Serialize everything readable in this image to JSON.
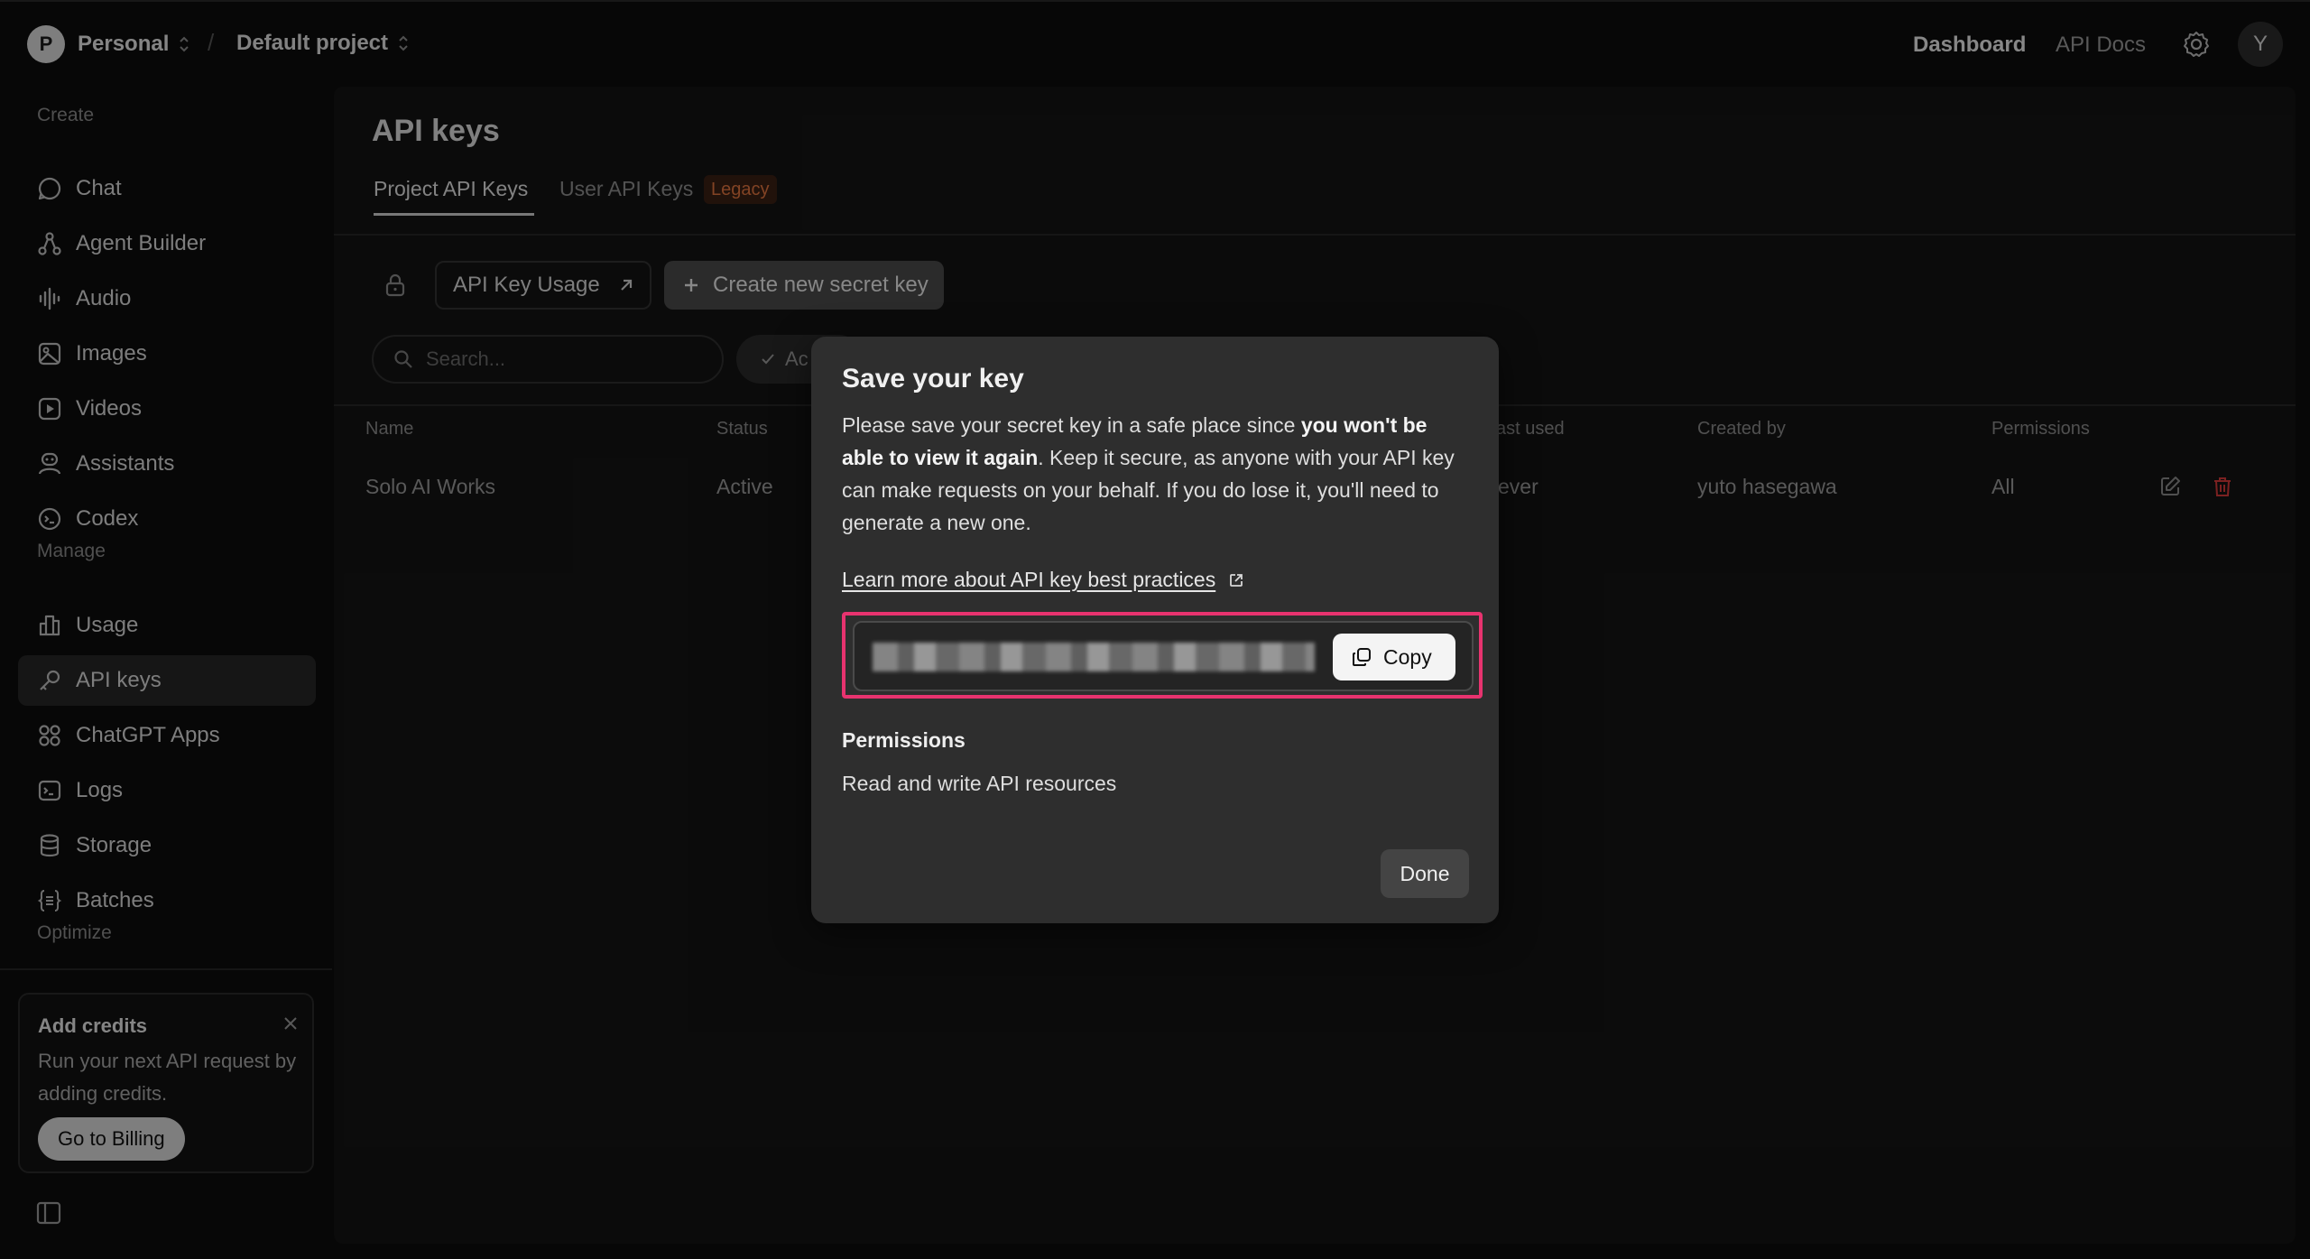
{
  "topbar": {
    "workspace_initial": "P",
    "workspace_name": "Personal",
    "project_name": "Default project",
    "separator": "/",
    "nav_dashboard": "Dashboard",
    "nav_api_docs": "API Docs",
    "user_initial": "Y"
  },
  "sidebar": {
    "section_create": "Create",
    "section_manage": "Manage",
    "section_optimize": "Optimize",
    "items": [
      {
        "label": "Chat",
        "icon": "chat-icon"
      },
      {
        "label": "Agent Builder",
        "icon": "agent-builder-icon"
      },
      {
        "label": "Audio",
        "icon": "audio-icon"
      },
      {
        "label": "Images",
        "icon": "images-icon"
      },
      {
        "label": "Videos",
        "icon": "videos-icon"
      },
      {
        "label": "Assistants",
        "icon": "assistants-icon"
      },
      {
        "label": "Codex",
        "icon": "codex-icon"
      },
      {
        "label": "Usage",
        "icon": "usage-icon"
      },
      {
        "label": "API keys",
        "icon": "key-icon",
        "active": true
      },
      {
        "label": "ChatGPT Apps",
        "icon": "apps-icon"
      },
      {
        "label": "Logs",
        "icon": "logs-icon"
      },
      {
        "label": "Storage",
        "icon": "storage-icon"
      },
      {
        "label": "Batches",
        "icon": "batches-icon"
      }
    ],
    "credits": {
      "title": "Add credits",
      "body": "Run your next API request by adding credits.",
      "button": "Go to Billing"
    }
  },
  "main": {
    "title": "API keys",
    "tabs": [
      {
        "label": "Project API Keys",
        "active": true
      },
      {
        "label": "User API Keys",
        "badge": "Legacy"
      }
    ],
    "usage_button": "API Key Usage",
    "create_button": "Create new secret key",
    "search_placeholder": "Search...",
    "filter_label": "Ac",
    "table": {
      "headers": [
        "Name",
        "Status",
        "ast used",
        "Created by",
        "Permissions"
      ],
      "rows": [
        {
          "name": "Solo AI Works",
          "status": "Active",
          "last_used": "ever",
          "created_by": "yuto hasegawa",
          "permissions": "All"
        }
      ]
    }
  },
  "modal": {
    "title": "Save your key",
    "body_1": "Please save your secret key in a safe place since ",
    "body_bold": "you won't be able to view it again",
    "body_2": ". Keep it secure, as anyone with your API key can make requests on your behalf. If you do lose it, you'll need to generate a new one.",
    "link": "Learn more about API key best practices",
    "copy_button": "Copy",
    "permissions_heading": "Permissions",
    "permissions_value": "Read and write API resources",
    "done_button": "Done"
  },
  "colors": {
    "background": "#0d0d0d",
    "panel": "#141414",
    "modal": "#2e2e2e",
    "highlight": "#e8336f",
    "legacy_badge": "#e0743f",
    "danger": "#d63a3a"
  }
}
